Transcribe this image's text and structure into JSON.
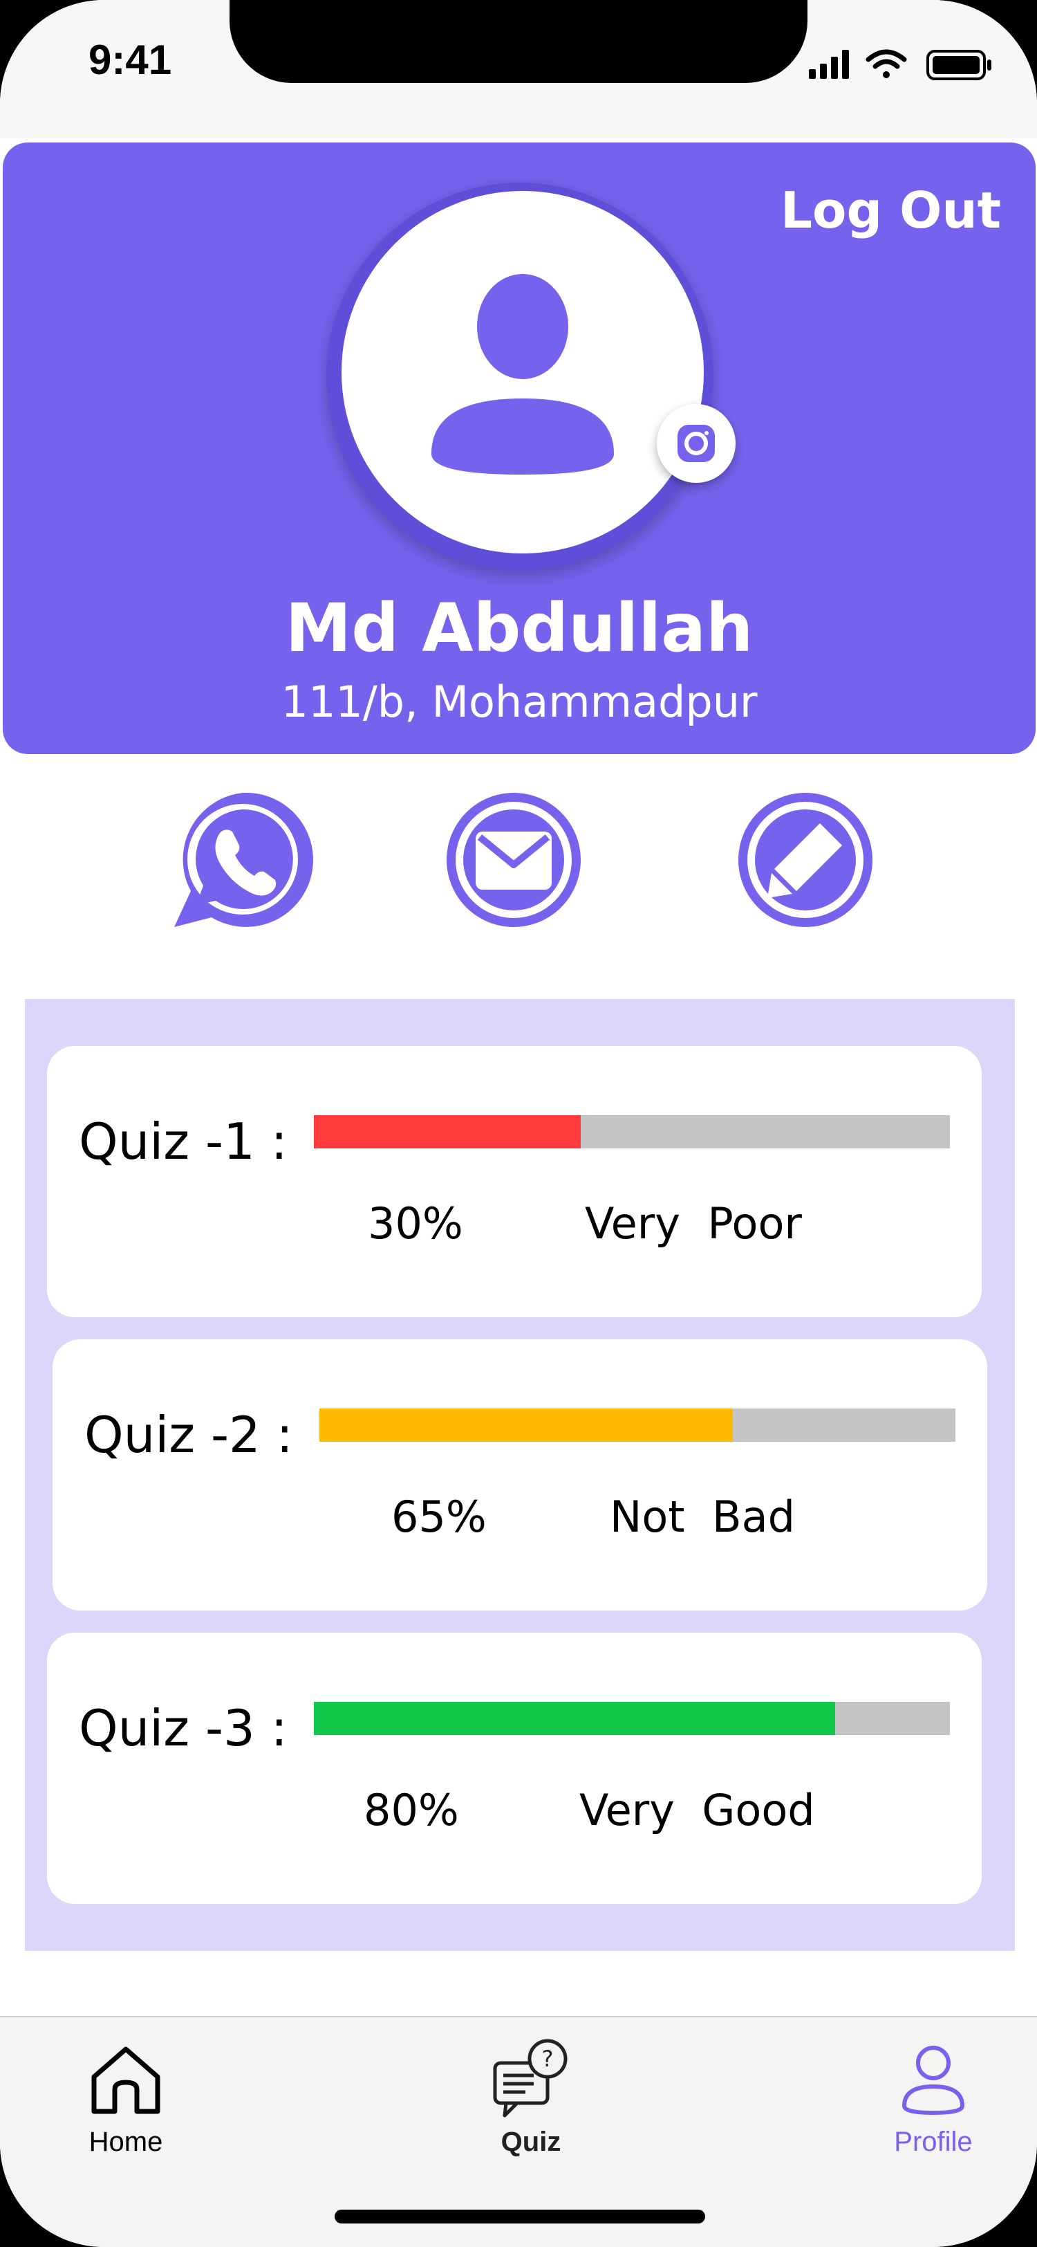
{
  "status_bar": {
    "time": "9:41"
  },
  "header": {
    "logout_label": "Log Out",
    "name": "Md Abdullah",
    "address": "111/b, Mohammadpur"
  },
  "contacts": [
    {
      "name": "whatsapp-icon"
    },
    {
      "name": "mail-icon"
    },
    {
      "name": "edit-icon"
    }
  ],
  "quizzes": [
    {
      "label": "Quiz -1 :",
      "percent_text": "30%",
      "rating": "Very  Poor",
      "progress": 0.42,
      "color": "#ff3b3b"
    },
    {
      "label": "Quiz -2 :",
      "percent_text": "65%",
      "rating": "Not  Bad",
      "progress": 0.65,
      "color": "#ffb800"
    },
    {
      "label": "Quiz -3 :",
      "percent_text": "80%",
      "rating": "Very  Good",
      "progress": 0.82,
      "color": "#12c84a"
    }
  ],
  "tabbar": {
    "home": "Home",
    "quiz": "Quiz",
    "profile": "Profile"
  },
  "colors": {
    "accent": "#7563ee",
    "panel": "#dcd6fa",
    "track": "#c4c4c4"
  }
}
